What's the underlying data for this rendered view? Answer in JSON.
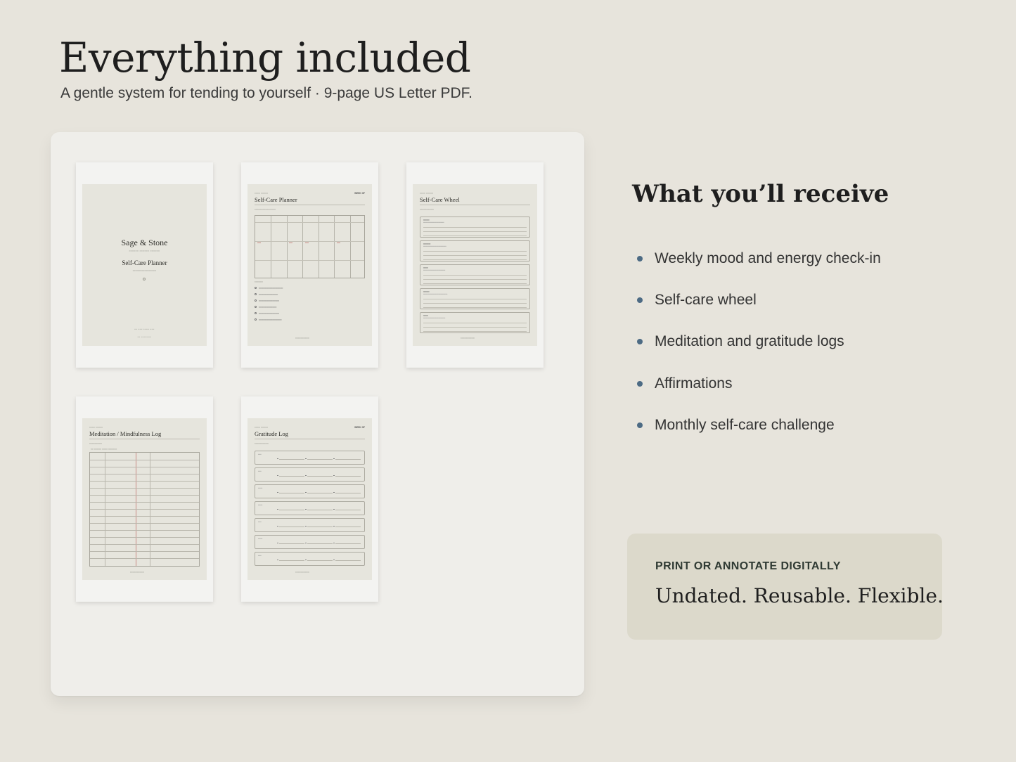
{
  "header": {
    "title": "Everything included",
    "subtitle": "A gentle system for tending to yourself · 9-page US Letter PDF."
  },
  "preview": {
    "cover": {
      "brand": "Sage & Stone",
      "title": "Self-Care Planner"
    },
    "planner": {
      "title": "Self-Care Planner",
      "week_label": "WEEK OF"
    },
    "wheel": {
      "title": "Self-Care Wheel"
    },
    "meditation": {
      "title": "Meditation / Mindfulness Log"
    },
    "gratitude": {
      "title": "Gratitude Log",
      "week_label": "WEEK OF"
    }
  },
  "receive": {
    "title": "What you’ll receive",
    "items": [
      "Weekly mood and energy check-in",
      "Self-care wheel",
      "Meditation and gratitude logs",
      "Affirmations",
      "Monthly self-care challenge"
    ],
    "bullet_color": "#4d6b84"
  },
  "info_card": {
    "eyebrow": "PRINT OR ANNOTATE DIGITALLY",
    "text": "Undated. Reusable. Flexible."
  },
  "colors": {
    "background": "#e7e4dc",
    "panel": "#efeeea",
    "card": "#dcd9cb",
    "sheet": "#e6e5dd"
  }
}
